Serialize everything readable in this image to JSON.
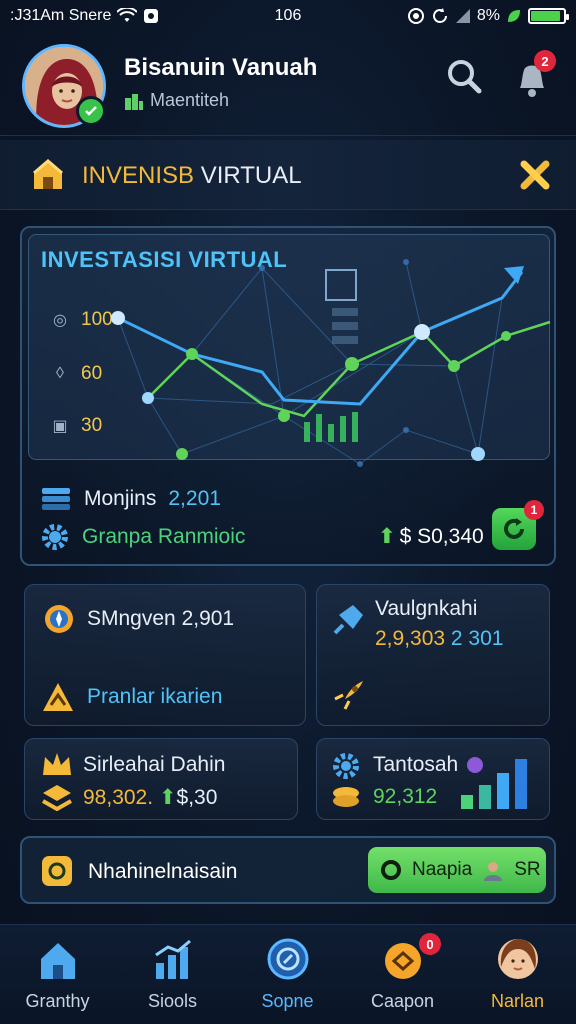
{
  "status_bar": {
    "left_text": ":J31Am Snere",
    "center_text": "106",
    "battery_text": "8%",
    "battery_level_percent": 90
  },
  "header": {
    "user_name": "Bisanuin Vanuah",
    "user_subtitle": "Maentiteh",
    "notification_count": "2"
  },
  "section": {
    "title_highlight": "INVENISB",
    "title_rest": " VIRTUAL"
  },
  "main_card": {
    "chart_title": "INVESTASISI VIRTUAL",
    "y_labels": [
      "100",
      "60",
      "30"
    ],
    "info_label": "Monjins",
    "info_value": "2,201",
    "sub_label": "Granpa Ranmioic",
    "amount": "$ S0,340",
    "action_badge": "1"
  },
  "tiles": {
    "t1": {
      "label": "SMngven",
      "value": "2,901"
    },
    "t2": {
      "title": "Vaulgnkahi",
      "value_a": "2,9,303",
      "value_b": "2 301"
    },
    "t3": {
      "label": "Pranlar ikarien"
    },
    "t5": {
      "title": "Sirleahai Dahin",
      "value_a": "98,302.",
      "value_b": "$,30"
    },
    "t6": {
      "title": "Tantosah",
      "value": "92,312"
    }
  },
  "banner": {
    "text": "Nhahinelnaisain",
    "button_label": "Naapia",
    "button_suffix": "SR"
  },
  "nav": [
    {
      "label": "Granthy",
      "icon": "house-icon"
    },
    {
      "label": "Siools",
      "icon": "chart-icon"
    },
    {
      "label": "Sopne",
      "icon": "globe-icon"
    },
    {
      "label": "Caapon",
      "icon": "coupon-icon",
      "badge": "0"
    },
    {
      "label": "Narlan",
      "icon": "profile-avatar"
    }
  ],
  "colors": {
    "accent_blue": "#4fc3f7",
    "accent_gold": "#f5b93a",
    "accent_green": "#4cd37a",
    "badge_red": "#e0263c"
  }
}
